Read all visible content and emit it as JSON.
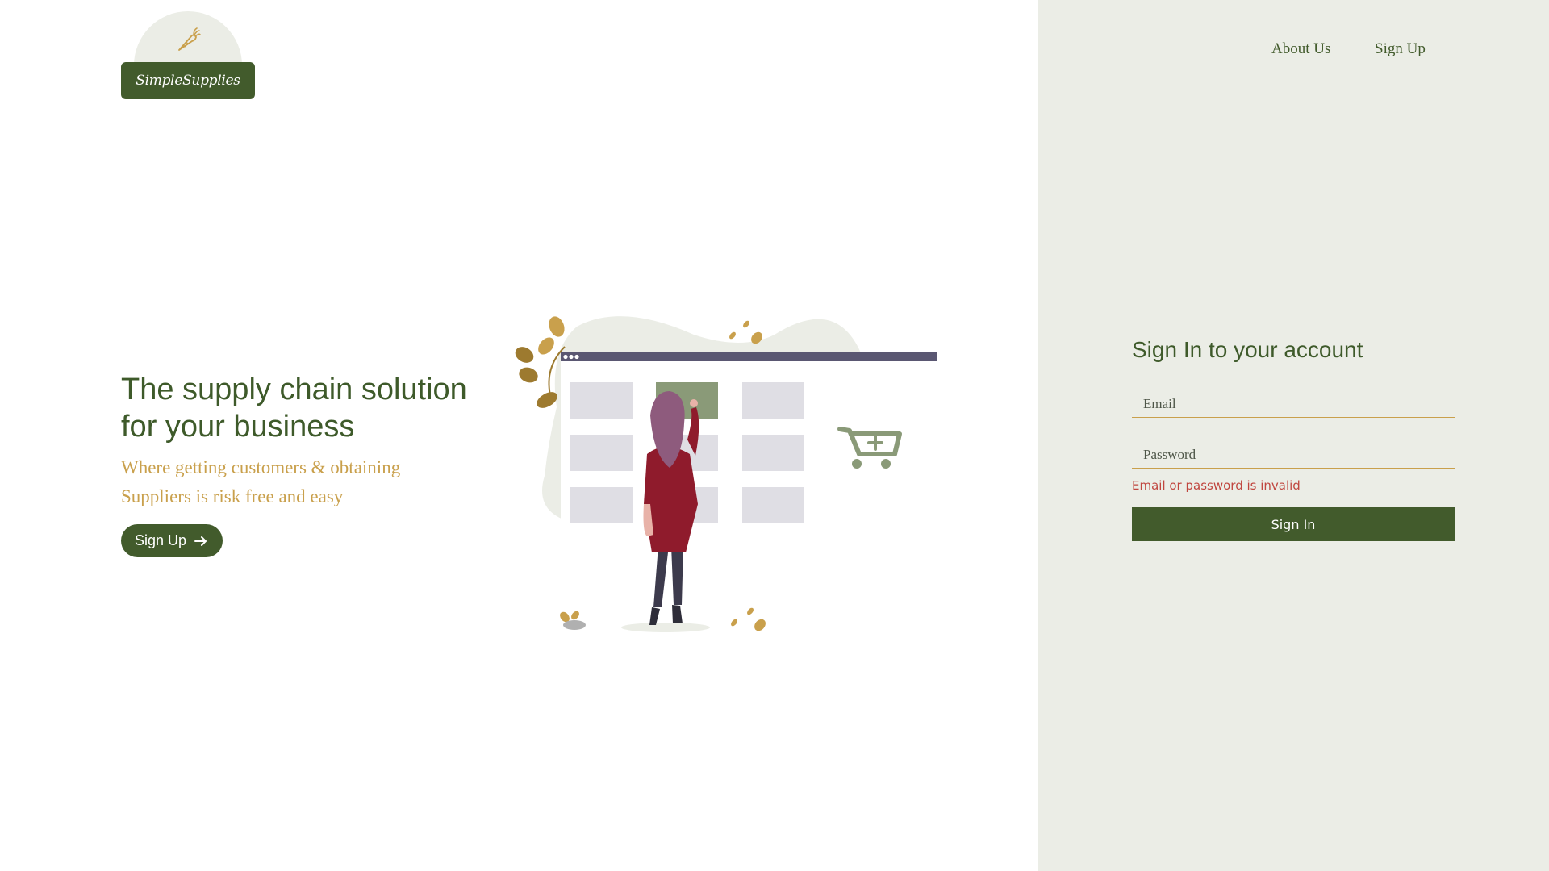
{
  "brand": {
    "name": "SimpleSupplies"
  },
  "nav": {
    "about_label": "About Us",
    "signup_label": "Sign Up"
  },
  "hero": {
    "title": "The supply chain solution for your business",
    "subtitle": "Where getting customers & obtaining Suppliers is risk free and easy",
    "cta_label": "Sign Up"
  },
  "signin": {
    "title": "Sign In to your account",
    "email_placeholder": "Email",
    "password_placeholder": "Password",
    "error": "Email or password is invalid",
    "button_label": "Sign In"
  },
  "colors": {
    "brand_green": "#425b2c",
    "accent_gold": "#c9a04c",
    "panel_bg": "#ebede6",
    "error_red": "#c0463f"
  },
  "icons": [
    "carrot-icon",
    "arrow-right-icon",
    "shopping-cart-icon"
  ]
}
